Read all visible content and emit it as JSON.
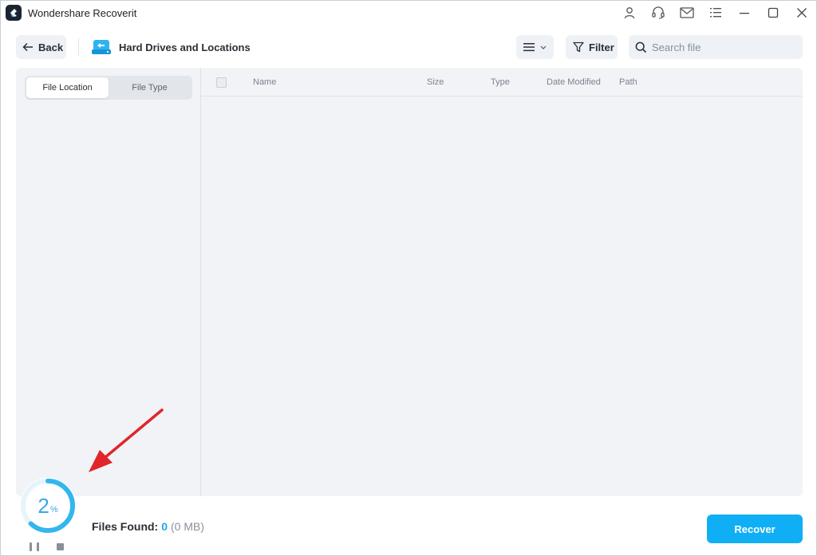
{
  "app": {
    "title": "Wondershare Recoverit"
  },
  "titlebar": {
    "icons": [
      "user-icon",
      "headset-icon",
      "mail-icon",
      "menu-icon",
      "minimize-icon",
      "maximize-icon",
      "close-icon"
    ]
  },
  "toolbar": {
    "back_label": "Back",
    "location_title": "Hard Drives and Locations",
    "filter_label": "Filter",
    "search_placeholder": "Search file"
  },
  "left_panel": {
    "tabs": [
      {
        "label": "File Location",
        "active": true
      },
      {
        "label": "File Type",
        "active": false
      }
    ]
  },
  "table": {
    "columns": [
      "Name",
      "Size",
      "Type",
      "Date Modified",
      "Path"
    ],
    "rows": []
  },
  "status": {
    "progress_value": "2",
    "progress_unit": "%",
    "progress_fraction": 0.02,
    "files_found_label": "Files Found:",
    "files_found_count": "0",
    "files_found_size": "(0 MB)"
  },
  "actions": {
    "recover_label": "Recover"
  },
  "colors": {
    "accent": "#10aff5",
    "progress": "#3aa6e8",
    "annotation": "#e0262b"
  }
}
